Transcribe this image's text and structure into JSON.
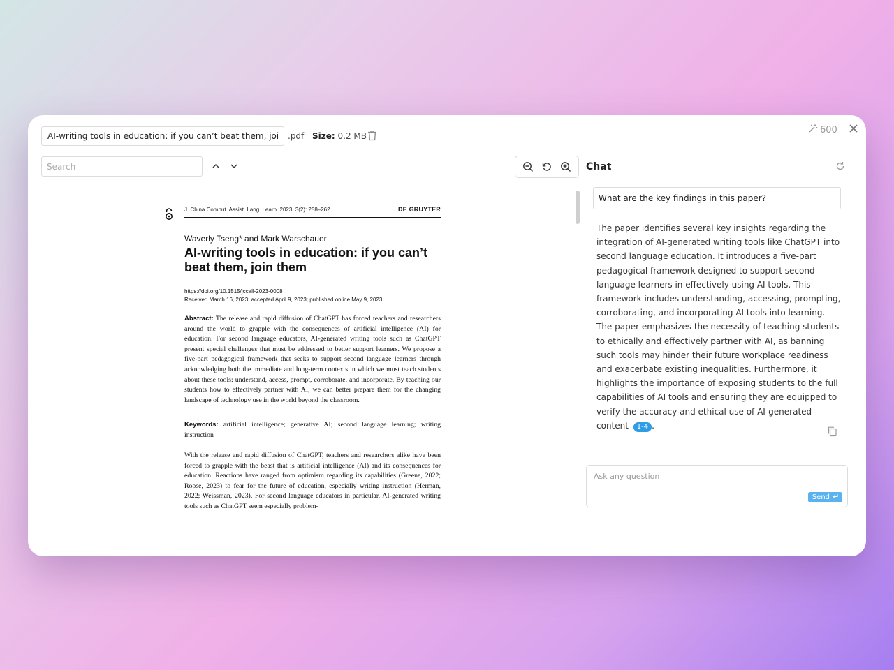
{
  "header": {
    "filename_value": "AI-writing tools in education: if you can’t beat them, join them",
    "extension": ".pdf",
    "size_label": "Size:",
    "size_value": "0.2 MB",
    "credits": "600"
  },
  "toolbar": {
    "search_placeholder": "Search"
  },
  "chat": {
    "title": "Chat",
    "question": "What are the key findings in this paper?",
    "answer": "The paper identifies several key insights regarding the integration of AI-generated writing tools like ChatGPT into second language education. It introduces a five-part pedagogical framework designed to support second language learners in effectively using AI tools. This framework includes understanding, accessing, prompting, corroborating, and incorporating AI tools into learning. The paper emphasizes the necessity of teaching students to ethically and effectively partner with AI, as banning such tools may hinder their future workplace readiness and exacerbate existing inequalities. Furthermore, it highlights the importance of exposing students to the full capabilities of AI tools and ensuring they are equipped to verify the accuracy and ethical use of AI-generated content",
    "citation": "1-4",
    "answer_end": ".",
    "input_placeholder": "Ask any question",
    "send_label": "Send"
  },
  "document": {
    "journal": "J. China Comput. Assist. Lang. Learn. 2023; 3(2): 258–262",
    "publisher": "DE GRUYTER",
    "authors": "Waverly Tseng* and Mark Warschauer",
    "title": "AI-writing tools in education: if you can’t beat them, join them",
    "doi": "https://doi.org/10.1515/jccall-2023-0008",
    "received": "Received March 16, 2023; accepted April 9, 2023; published online May 9, 2023",
    "abstract_label": "Abstract:",
    "abstract": "The release and rapid diffusion of ChatGPT has forced teachers and researchers around the world to grapple with the consequences of artificial intelligence (AI) for education. For second language educators, AI-generated writing tools such as ChatGPT present special challenges that must be addressed to better support learners. We propose a five-part pedagogical framework that seeks to support second language learners through acknowledging both the immediate and long-term contexts in which we must teach students about these tools: understand, access, prompt, corroborate, and incorporate. By teaching our students how to effectively partner with AI, we can better prepare them for the changing landscape of technology use in the world beyond the classroom.",
    "keywords_label": "Keywords:",
    "keywords": "artificial intelligence; generative AI; second language learning; writing instruction",
    "body": "With the release and rapid diffusion of ChatGPT, teachers and researchers alike have been forced to grapple with the beast that is artificial intelligence (AI) and its consequences for education. Reactions have ranged from optimism regarding its capabilities (Greene, 2022; Roose, 2023) to fear for the future of education, especially writing instruction (Herman, 2022; Weissman, 2023). For second language educators in particular, AI-generated writing tools such as ChatGPT seem especially problem-"
  },
  "colors": {
    "accent": "#2f9ce6",
    "send_button": "#5ab2ee"
  }
}
